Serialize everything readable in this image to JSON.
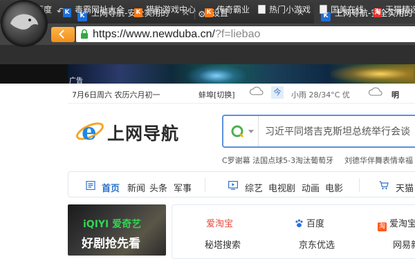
{
  "browser": {
    "tabs": [
      {
        "title": "上网导航-安全实用的"
      },
      {
        "title": "设置"
      },
      {
        "title": "上网导航-安全实用的"
      }
    ],
    "url_main": "https://www.newduba.cn/",
    "url_rest": "?f=liebao"
  },
  "bookmarks": [
    {
      "label": "百度"
    },
    {
      "label": "毒霸网址大全"
    },
    {
      "label": "猎豹游戏中心"
    },
    {
      "label": "传奇霸业"
    },
    {
      "label": "热门小游戏"
    },
    {
      "label": "国美在线"
    },
    {
      "label": "天猫精选"
    }
  ],
  "banner": {
    "ad_label": "广告"
  },
  "info": {
    "date": "7月6日周六  农历六月初一",
    "city": "蚌埠[切换]",
    "today_badge": "今",
    "weather": "小雨 28/34°C 优",
    "tomorrow": "明"
  },
  "site": {
    "title": "上网导航"
  },
  "search": {
    "query": "习近平同塔吉克斯坦总统举行会谈",
    "hot_left": "C罗谢幕 法国点球5-3淘汰葡萄牙",
    "hot_right": "刘德华伴舞表情幸福"
  },
  "categories": [
    {
      "label": "首页"
    },
    {
      "label": "新闻"
    },
    {
      "label": "头条"
    },
    {
      "label": "军事"
    },
    {
      "label": "综艺"
    },
    {
      "label": "电视剧"
    },
    {
      "label": "动画"
    },
    {
      "label": "电影"
    },
    {
      "label": "天猫"
    }
  ],
  "promo": {
    "brand": "iQIYI 爱奇艺",
    "tagline": "好剧抢先看"
  },
  "links": [
    {
      "label": "爱淘宝"
    },
    {
      "label": "百度"
    },
    {
      "label": "爱淘宝"
    },
    {
      "label": "秘塔搜索"
    },
    {
      "label": "京东优选"
    },
    {
      "label": "网易新闻"
    }
  ],
  "colors": {
    "accent": "#2a72c8",
    "orange": "#f08f1a",
    "search_border": "#5b8fe0"
  }
}
